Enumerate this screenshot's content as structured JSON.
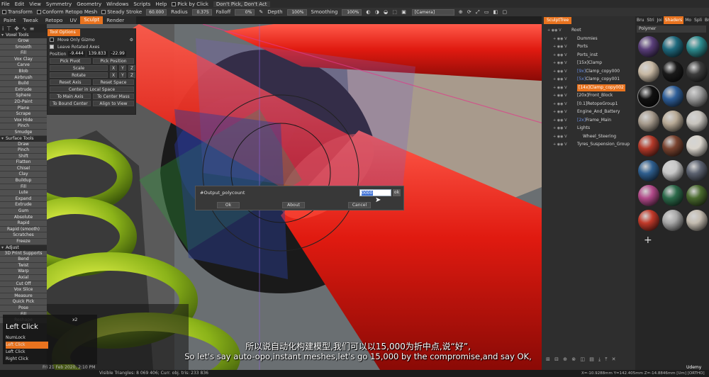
{
  "menubar": {
    "items": [
      "File",
      "Edit",
      "View",
      "Symmetry",
      "Geometry",
      "Windows",
      "Scripts",
      "Help"
    ],
    "pick_by_click_label": "Pick by Click",
    "pick_mode_value": "Don't Pick, Don't Act"
  },
  "toolbar": {
    "transform_label": "Transform",
    "conform_label": "Conform Retopo Mesh",
    "steady_stroke_label": "Steady Stroke",
    "steady_stroke_value": "60.000",
    "radius_label": "Radius",
    "radius_value": "0.375",
    "falloff_label": "Falloff",
    "falloff_value": "0%",
    "depth_label": "Depth",
    "depth_value": "100%",
    "smoothing_label": "Smoothing",
    "smoothing_value": "100%",
    "camera_value": "[Camera]"
  },
  "rooms": [
    "Paint",
    "Tweak",
    "Retopo",
    "UV",
    "Sculpt",
    "Render"
  ],
  "active_room": "Sculpt",
  "left_panel": {
    "voxel_tools_header": "Voxel Tools",
    "voxel_tools": [
      "Grow",
      "Smooth",
      "Fill",
      "Vox Clay",
      "Carve",
      "Blob",
      "Airbrush",
      "Build",
      "Extrude",
      "Sphere",
      "2D-Paint",
      "Plane",
      "Scrape",
      "Vox Hide",
      "Pinch",
      "Smudge"
    ],
    "surface_tools_header": "Surface Tools",
    "surface_tools": [
      "Draw",
      "Pinch",
      "Shift",
      "Flatten",
      "Chisel",
      "Clay",
      "Buildup",
      "Fill",
      "Lute",
      "Expand",
      "Extrude",
      "Gum",
      "Absolute",
      "Rapid",
      "Rapid (smooth)",
      "Scratches",
      "Freeze"
    ],
    "adjust_header": "Adjust",
    "adjust_tools": [
      "3D Print Supports",
      "Bend",
      "Twist",
      "Warp",
      "Axial",
      "Cut Off",
      "Vox Slice",
      "Measure",
      "Quick Pick",
      "Pose",
      "Fill",
      "Reshape"
    ]
  },
  "tool_options": {
    "header": "Tool Options",
    "move_only_gizmo": "Move Only Gizmo",
    "leave_rotated_axes": "Leave Rotated Axes",
    "position_label": "Position",
    "position_values": [
      "-9.444",
      "139.833",
      "-22.99"
    ],
    "pick_pivot": "Pick Pivot",
    "pick_position": "Pick Position",
    "scale": "Scale",
    "rotate": "Rotate",
    "axes": [
      "X",
      "Y",
      "Z"
    ],
    "reset_axis": "Reset Axis",
    "reset_space": "Reset Space",
    "center_in_local_space": "Center in Local Space",
    "to_main_axis": "To Main Axis",
    "to_center_mass": "To Center Mass",
    "to_bound_center": "To Bound Center",
    "align_to_view": "Align to View"
  },
  "dialog": {
    "title": "#Output_polycount",
    "value": "0000",
    "ok_small": "ok",
    "ok_button": "Ok",
    "about_button": "About",
    "cancel_button": "Cancel"
  },
  "sculpt_tree": {
    "tab_label": "SculptTree",
    "rows": [
      {
        "prefix": "",
        "name": "Root"
      },
      {
        "prefix": "",
        "name": "Dummies"
      },
      {
        "prefix": "",
        "name": "Ports"
      },
      {
        "prefix": "",
        "name": "Ports_inst"
      },
      {
        "prefix": "",
        "name": "[15x]Clamp"
      },
      {
        "prefix": "[9x]",
        "name": "Clamp_copy000"
      },
      {
        "prefix": "[5x]",
        "name": "Clamp_copy001"
      },
      {
        "prefix": "",
        "name": "[14x]Clamp_copy002"
      },
      {
        "prefix": "",
        "name": "[20x]Front_Block"
      },
      {
        "prefix": "",
        "name": "[0.1]RetopoGroup1"
      },
      {
        "prefix": "",
        "name": "Engine_And_Battery"
      },
      {
        "prefix": "[2x]",
        "name": "Frame_Main"
      },
      {
        "prefix": "",
        "name": "Lights"
      },
      {
        "prefix": "",
        "name": "Wheel_Steering"
      },
      {
        "prefix": "",
        "name": "Tyres_Suspension_Group"
      }
    ],
    "selected": "[14x]Clamp_copy002"
  },
  "shaders": {
    "tabs": [
      "Bru",
      "Stri",
      "Joi",
      "Shaders",
      "Mo",
      "Spli",
      "Bri"
    ],
    "active_tab": "Shaders",
    "library": "Polymer",
    "add_label": "+",
    "swatches": [
      "#5a3f7a",
      "#1f6a7e",
      "#2d8b8e",
      "#c8b9a4",
      "#1a1a1a",
      "#3c3c3c",
      "#111111",
      "#2f5f99",
      "#9a9a9a",
      "#a89c8e",
      "#b8aa96",
      "#c8c4be",
      "#b43a2a",
      "#7a4430",
      "#d9d4cc",
      "#2f5f8f",
      "#c7c7c7",
      "#5c6270",
      "#b24a8a",
      "#2c6a4a",
      "#4a6a2e",
      "#c23a2a",
      "#a8a8a8",
      "#c4bcb0"
    ]
  },
  "status_bar": {
    "left_text": "Fri 21 Feb 2020, 2:10 PM",
    "stats": "Visible Triangles: 8 069 406; Curr. obj. tris: 233 836",
    "coords": "X=-10.9288mm  Y=142.405mm  Z=-14.8846mm  [Um]  [ORTHO]",
    "watermark": "Udemy"
  },
  "key_overlay": {
    "title": "Left Click",
    "count": "x2",
    "lines": [
      "NumLock",
      "Left Click",
      "Left Click",
      "Right Click"
    ]
  },
  "subtitles": {
    "chinese": "所以说自动化构建模型,我们可以以15,000为折中点,说“好”,",
    "english": "So let's say auto-opo,instant meshes,let's go 15,000 by the compromise,and say OK,"
  }
}
